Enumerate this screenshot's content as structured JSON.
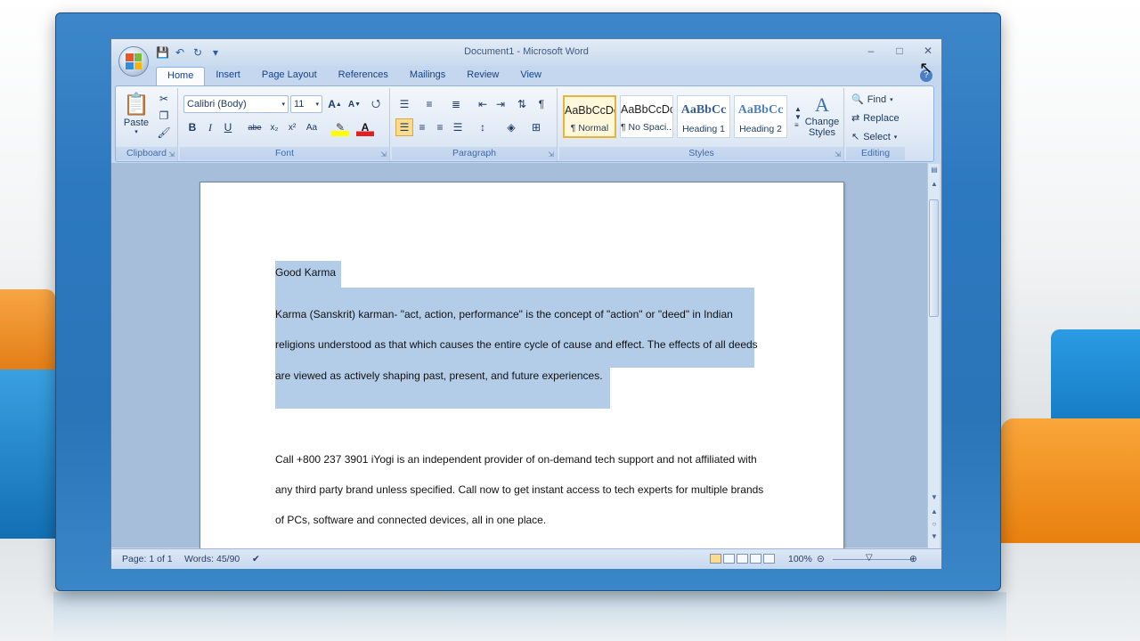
{
  "window": {
    "title": "Document1 - Microsoft Word"
  },
  "quick_access": {
    "icons": [
      "save-icon",
      "undo-icon",
      "redo-icon",
      "customize-icon"
    ]
  },
  "window_controls": [
    "minimize-icon",
    "maximize-icon",
    "close-icon"
  ],
  "tabs": [
    {
      "label": "Home",
      "active": true
    },
    {
      "label": "Insert"
    },
    {
      "label": "Page Layout"
    },
    {
      "label": "References"
    },
    {
      "label": "Mailings"
    },
    {
      "label": "Review"
    },
    {
      "label": "View"
    }
  ],
  "ribbon": {
    "clipboard": {
      "label": "Clipboard",
      "paste": "Paste"
    },
    "font": {
      "label": "Font",
      "family": "Calibri (Body)",
      "size": "11",
      "buttons": [
        "B",
        "I",
        "U",
        "abe",
        "x₂",
        "x²",
        "Aa"
      ]
    },
    "paragraph": {
      "label": "Paragraph"
    },
    "styles": {
      "label": "Styles",
      "items": [
        {
          "preview": "AaBbCcDc",
          "name": "¶ Normal",
          "selected": true
        },
        {
          "preview": "AaBbCcDc",
          "name": "¶ No Spaci..."
        },
        {
          "preview": "AaBbCc",
          "name": "Heading 1"
        },
        {
          "preview": "AaBbCc",
          "name": "Heading 2"
        }
      ],
      "change_styles": "Change Styles"
    },
    "editing": {
      "label": "Editing",
      "find": "Find",
      "replace": "Replace",
      "select": "Select"
    }
  },
  "document": {
    "title_line": "Good Karma",
    "para1": [
      "Karma (Sanskrit) karman- \"act, action, performance\" is the concept of \"action\" or \"deed\" in Indian",
      "religions understood as that which causes the entire cycle of cause and effect. The effects of all deeds",
      "are viewed as actively shaping past, present, and future experiences."
    ],
    "para2": [
      "Call +800 237 3901  iYogi is an independent provider of on-demand tech support and not affiliated with",
      "any third party brand unless specified. Call now to get instant access to tech experts for multiple brands",
      "of PCs, software and connected devices, all in one place."
    ]
  },
  "status": {
    "page": "Page: 1 of 1",
    "words": "Words: 45/90",
    "zoom": "100%"
  },
  "colors": {
    "selection": "#b3cde9",
    "ribbon": "#dfe9f5",
    "highlight": "#e7b43b"
  }
}
